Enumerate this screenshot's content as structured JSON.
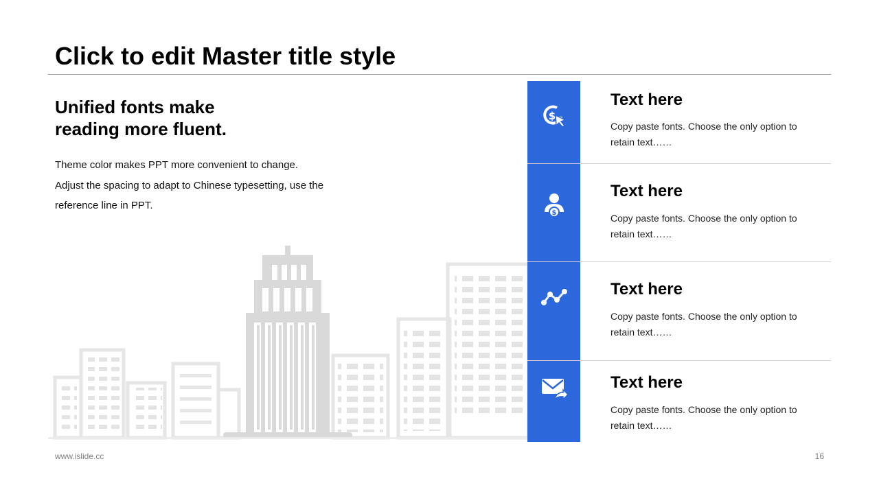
{
  "slide": {
    "title": "Click to edit Master title style"
  },
  "left": {
    "heading_line1": "Unified fonts make",
    "heading_line2": "reading more fluent.",
    "body_lines": [
      "Theme color makes PPT more convenient to change.",
      "Adjust the spacing to adapt to Chinese typesetting, use the",
      "reference line in PPT."
    ]
  },
  "features": [
    {
      "icon": "dollar-click-icon",
      "title": "Text here",
      "desc": "Copy paste fonts. Choose the only option to retain text……"
    },
    {
      "icon": "person-money-icon",
      "title": "Text here",
      "desc": "Copy paste fonts. Choose the only option to retain text……"
    },
    {
      "icon": "trend-line-icon",
      "title": "Text here",
      "desc": "Copy paste fonts. Choose the only option to retain text……"
    },
    {
      "icon": "mail-forward-icon",
      "title": "Text here",
      "desc": "Copy paste fonts. Choose the only option to retain text……"
    }
  ],
  "footer": {
    "url": "www.islide.cc",
    "page": "16"
  },
  "colors": {
    "accent": "#2c67dc",
    "city": "#e3e3e3",
    "rule": "#a6a6a6"
  }
}
